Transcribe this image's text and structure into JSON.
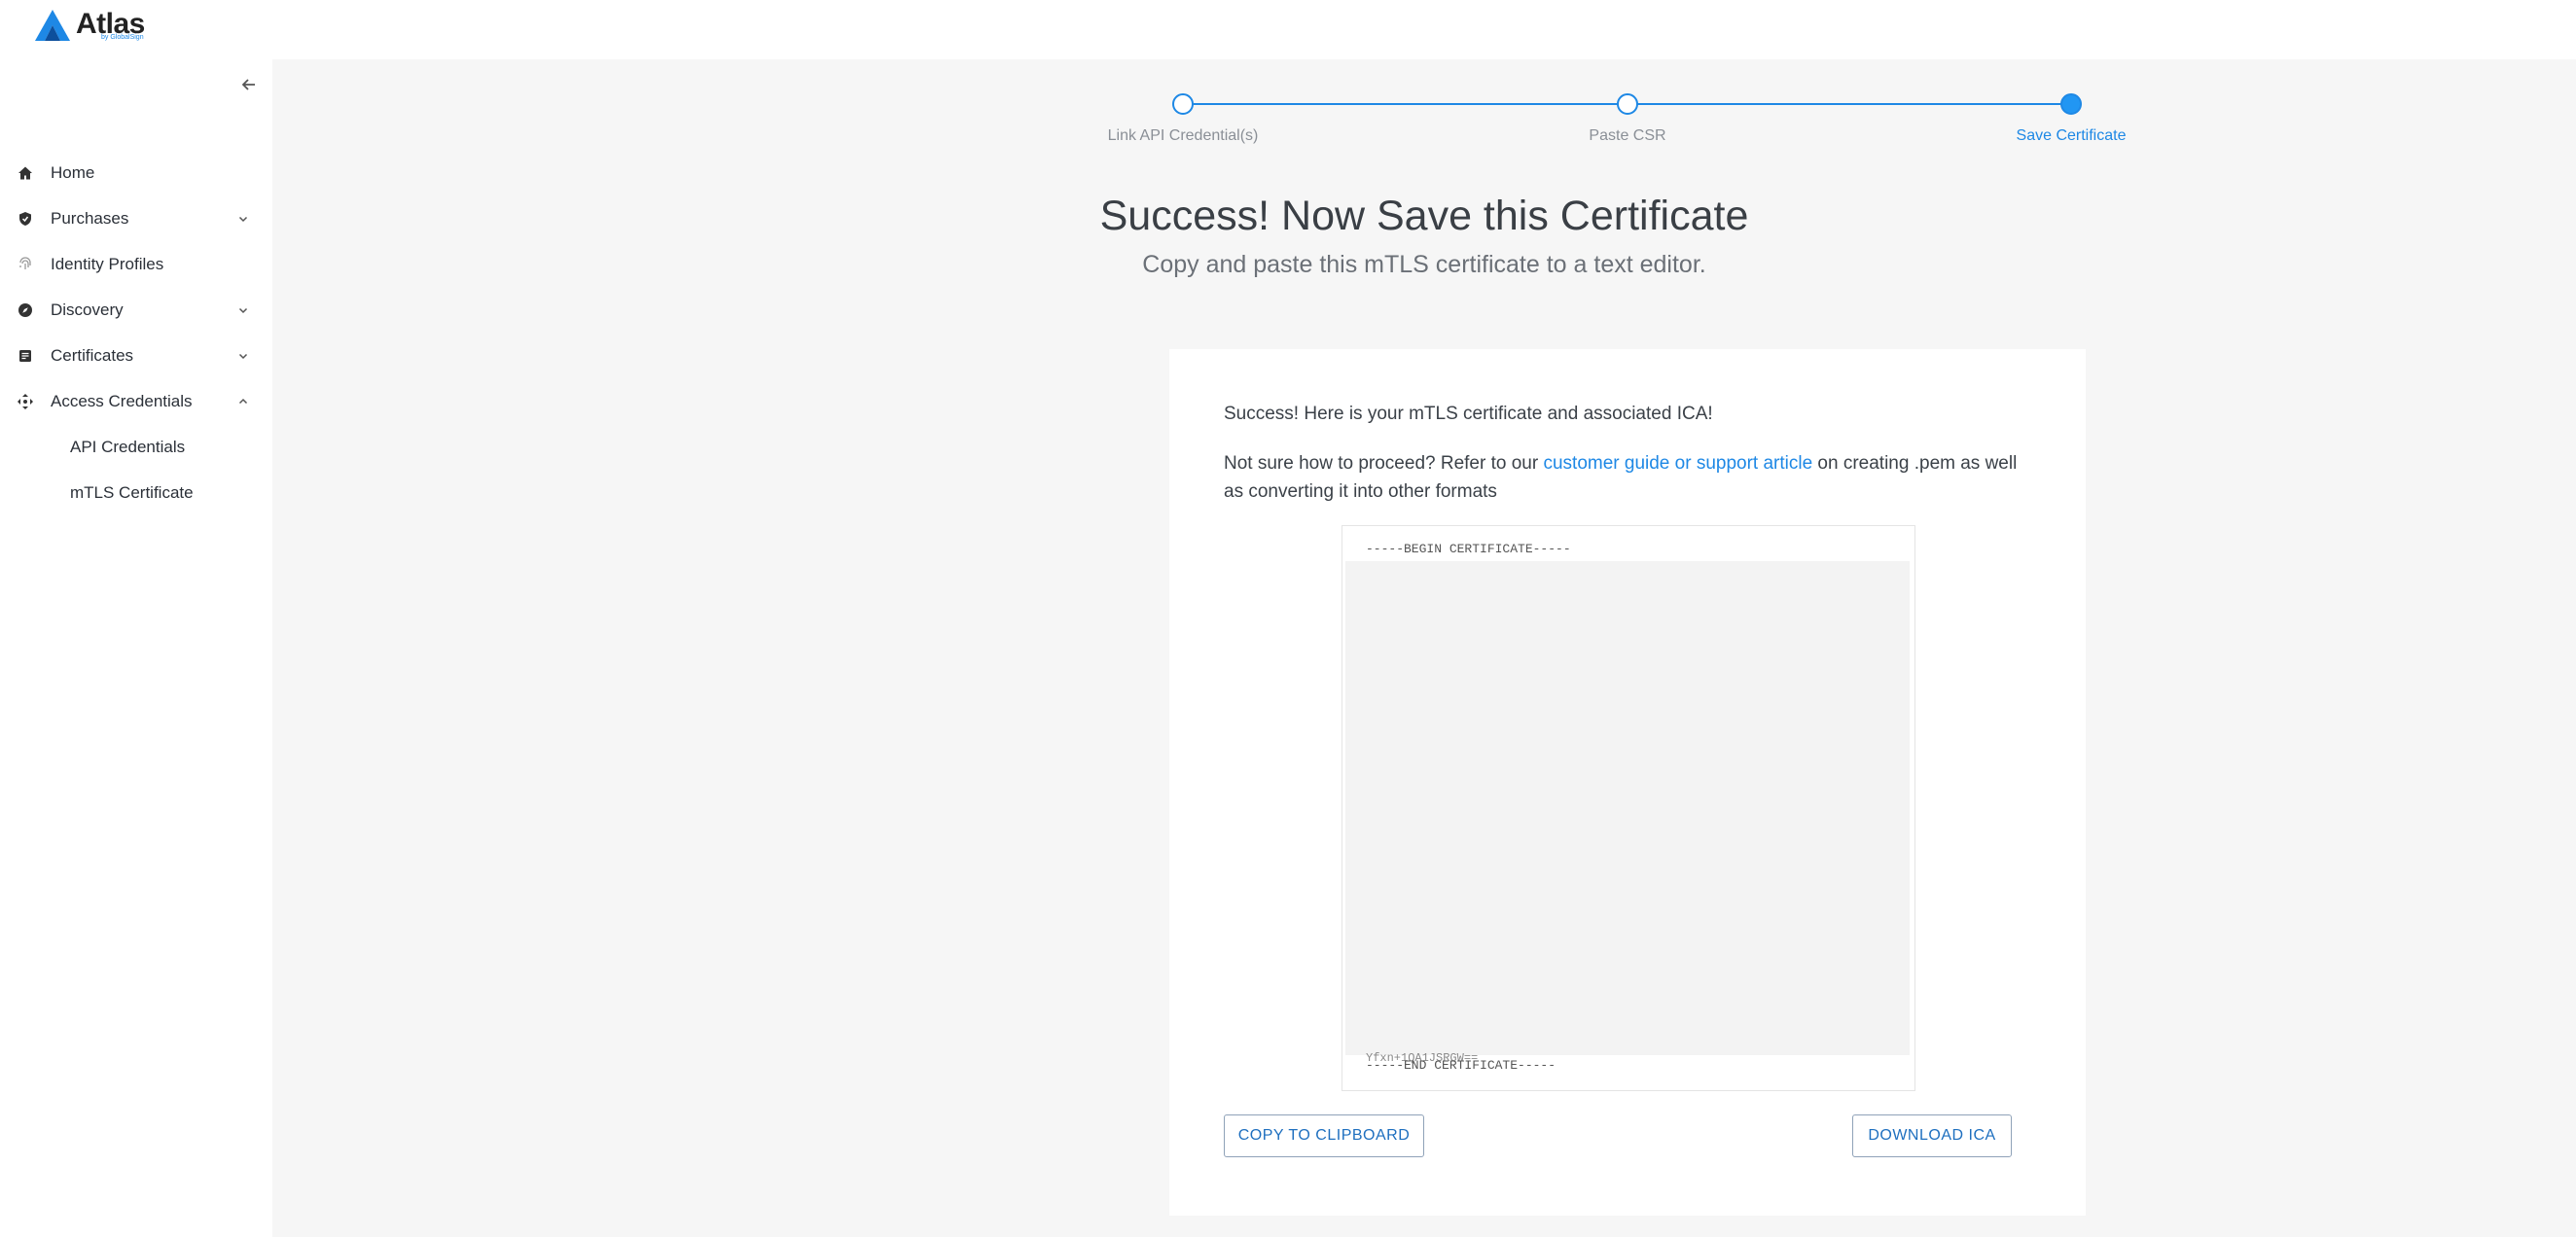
{
  "app": {
    "logo_text": "Atlas",
    "logo_sub": "by GlobalSign"
  },
  "sidebar": {
    "items": [
      {
        "label": "Home",
        "icon": "home-icon",
        "expandable": false
      },
      {
        "label": "Purchases",
        "icon": "shield-icon",
        "expandable": true,
        "expanded": false
      },
      {
        "label": "Identity Profiles",
        "icon": "fingerprint-icon",
        "expandable": false
      },
      {
        "label": "Discovery",
        "icon": "compass-icon",
        "expandable": true,
        "expanded": false
      },
      {
        "label": "Certificates",
        "icon": "document-icon",
        "expandable": true,
        "expanded": false
      },
      {
        "label": "Access Credentials",
        "icon": "move-arrows-icon",
        "expandable": true,
        "expanded": true
      }
    ],
    "subitems": [
      {
        "label": "API Credentials"
      },
      {
        "label": "mTLS Certificate"
      }
    ]
  },
  "stepper": {
    "steps": [
      {
        "label": "Link API Credential(s)",
        "state": "done"
      },
      {
        "label": "Paste CSR",
        "state": "done"
      },
      {
        "label": "Save Certificate",
        "state": "active"
      }
    ]
  },
  "main": {
    "title": "Success! Now Save this Certificate",
    "subtitle": "Copy and paste this mTLS certificate to a text editor."
  },
  "card": {
    "success_text": "Success! Here is your mTLS certificate and associated ICA!",
    "help_prefix": "Not sure how to proceed? Refer to our ",
    "help_link": "customer guide or support article",
    "help_suffix": " on creating .pem as well as converting it into other formats",
    "cert_begin": "-----BEGIN CERTIFICATE-----",
    "cert_tail": "Yfxn+1QA1JSRGW==",
    "cert_end": "-----END CERTIFICATE-----",
    "copy_button": "COPY TO CLIPBOARD",
    "download_button": "DOWNLOAD ICA"
  },
  "colors": {
    "accent": "#1e88e5",
    "main_bg": "#f6f6f6"
  }
}
